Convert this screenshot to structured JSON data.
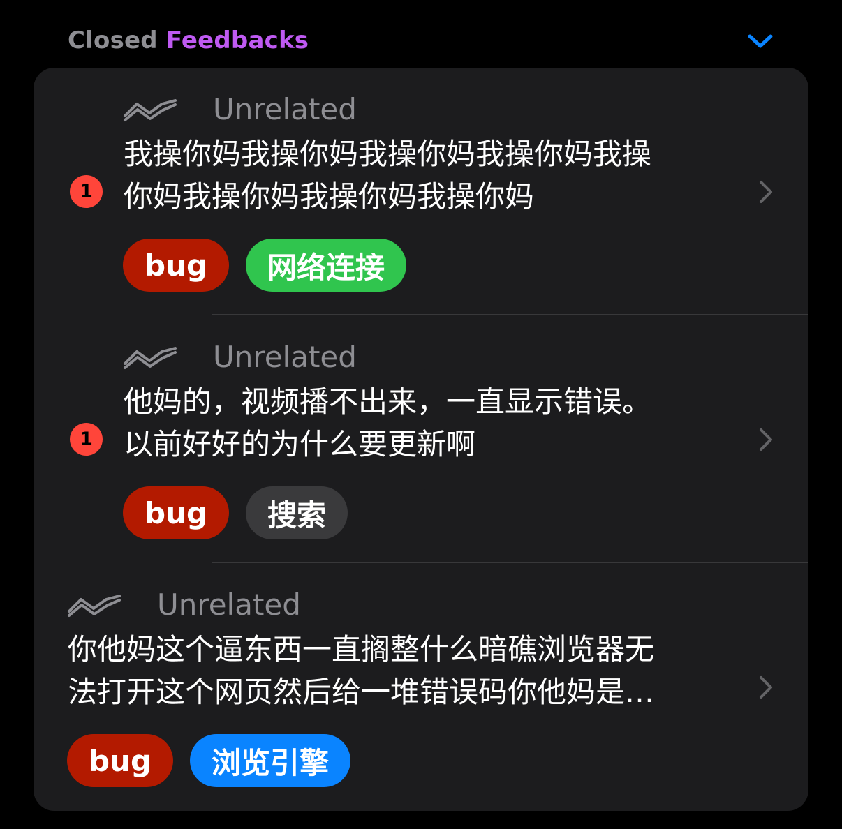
{
  "header": {
    "prefix": "Closed",
    "title": "Feedbacks",
    "accent_color": "#bf5af2",
    "collapse_icon": "chevron-down-icon"
  },
  "items": [
    {
      "badge": "1",
      "status_icon": "trend-icon",
      "status": "Unrelated",
      "lines": [
        "我操你妈我操你妈我操你妈我操你妈我操",
        "你妈我操你妈我操你妈我操你妈"
      ],
      "tags": [
        {
          "label": "bug",
          "color": "#b31a00"
        },
        {
          "label": "网络连接",
          "color": "#30c54e"
        }
      ]
    },
    {
      "badge": "1",
      "status_icon": "trend-icon",
      "status": "Unrelated",
      "lines": [
        "他妈的，视频播不出来，一直显示错误。",
        "以前好好的为什么要更新啊"
      ],
      "tags": [
        {
          "label": "bug",
          "color": "#b31a00"
        },
        {
          "label": "搜索",
          "color": "#3a3a3c"
        }
      ]
    },
    {
      "status_icon": "trend-icon",
      "status": "Unrelated",
      "lines": [
        "你他妈这个逼东西一直搁整什么暗礁浏览器无",
        "法打开这个网页然后给一堆错误码你他妈是…"
      ],
      "tags": [
        {
          "label": "bug",
          "color": "#b31a00"
        },
        {
          "label": "浏览引擎",
          "color": "#0a84ff"
        }
      ]
    }
  ]
}
